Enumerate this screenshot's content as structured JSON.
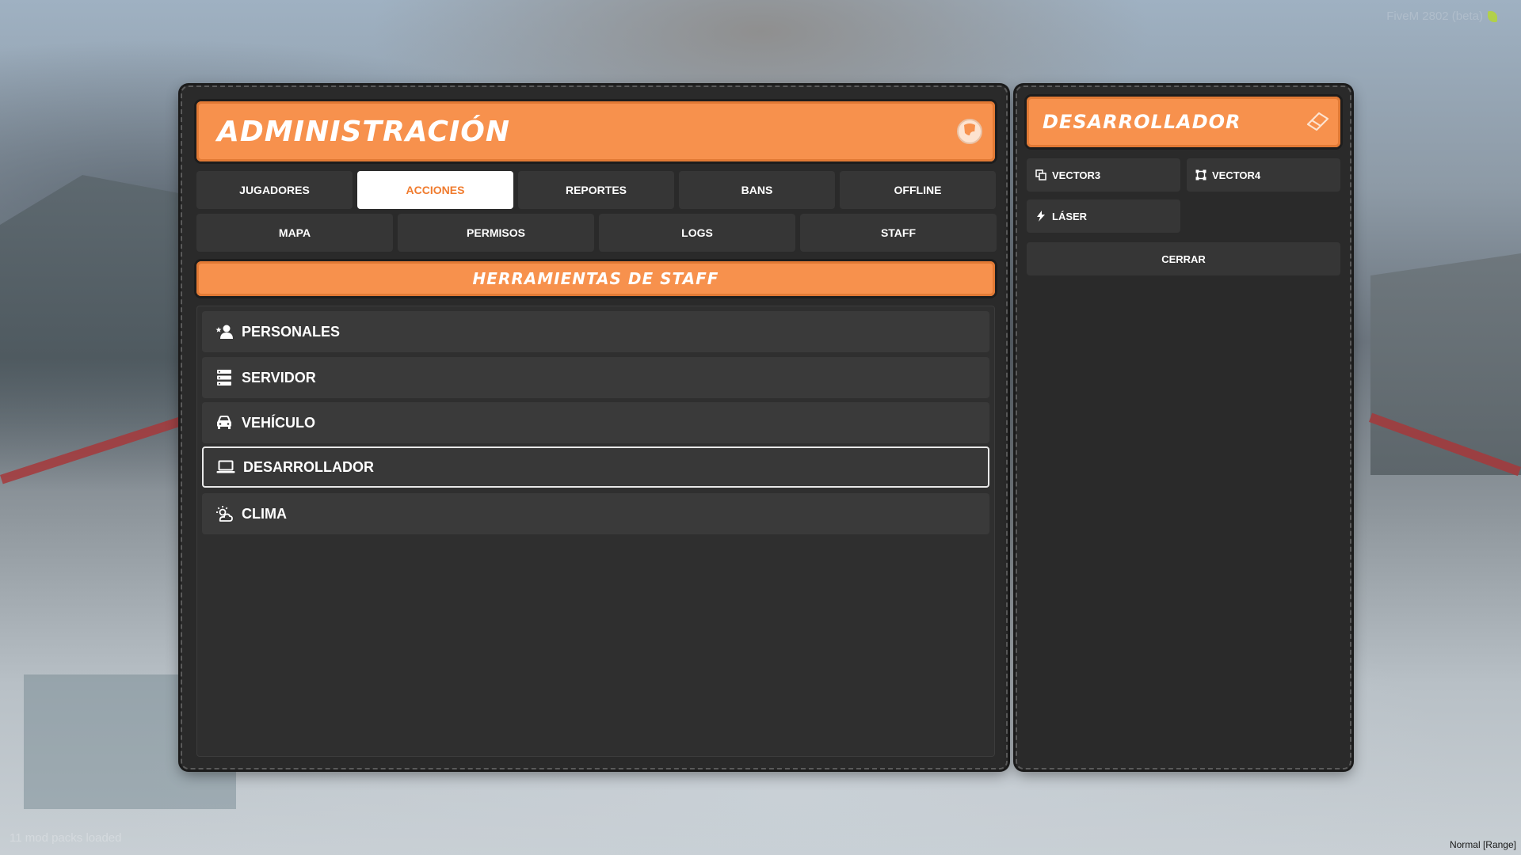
{
  "background": {
    "watermark": "FiveM 2802 (beta)",
    "footer_left": "11 mod packs loaded",
    "footer_right": "Normal [Range]"
  },
  "colors": {
    "accent": "#f7914d",
    "panel": "#2a2a2a",
    "tab": "#363636",
    "active_tab_bg": "#ffffff",
    "active_tab_text": "#f07b2e"
  },
  "main": {
    "title": "ADMINISTRACIÓN",
    "title_icon": "shield-badge-icon",
    "tabs_row1": [
      {
        "label": "JUGADORES",
        "active": false
      },
      {
        "label": "ACCIONES",
        "active": true
      },
      {
        "label": "REPORTES",
        "active": false
      },
      {
        "label": "BANS",
        "active": false
      },
      {
        "label": "OFFLINE",
        "active": false
      }
    ],
    "tabs_row2": [
      {
        "label": "MAPA"
      },
      {
        "label": "PERMISOS"
      },
      {
        "label": "LOGS"
      },
      {
        "label": "STAFF"
      }
    ],
    "section_title": "HERRAMIENTAS DE STAFF",
    "items": [
      {
        "label": "PERSONALES",
        "icon": "user-star-icon",
        "selected": false
      },
      {
        "label": "SERVIDOR",
        "icon": "server-icon",
        "selected": false
      },
      {
        "label": "VEHÍCULO",
        "icon": "car-icon",
        "selected": false
      },
      {
        "label": "DESARROLLADOR",
        "icon": "laptop-icon",
        "selected": true
      },
      {
        "label": "CLIMA",
        "icon": "weather-icon",
        "selected": false
      }
    ]
  },
  "side": {
    "title": "DESARROLLADOR",
    "title_icon": "eraser-icon",
    "buttons": [
      {
        "label": "VECTOR3",
        "icon": "copy-icon"
      },
      {
        "label": "VECTOR4",
        "icon": "frame-icon"
      },
      {
        "label": "LÁSER",
        "icon": "bolt-icon"
      }
    ],
    "close_label": "CERRAR"
  }
}
